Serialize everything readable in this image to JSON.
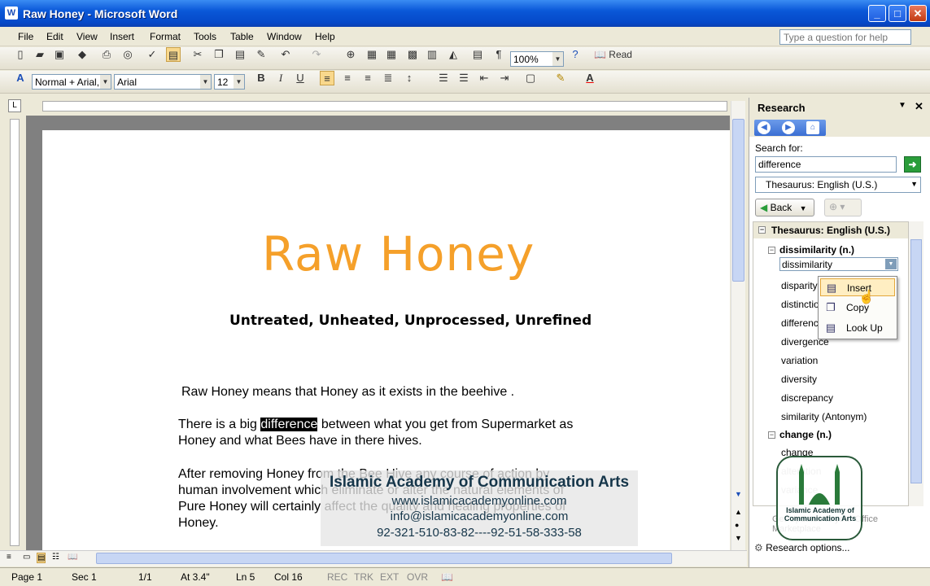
{
  "window": {
    "title": "Raw Honey - Microsoft Word",
    "app_icon": "W"
  },
  "menubar": {
    "items": [
      "File",
      "Edit",
      "View",
      "Insert",
      "Format",
      "Tools",
      "Table",
      "Window",
      "Help"
    ],
    "help_placeholder": "Type a question for help"
  },
  "toolbar1": {
    "zoom": "100%",
    "read_label": "Read"
  },
  "toolbar2": {
    "style": "Normal + Arial,",
    "font": "Arial",
    "size": "12"
  },
  "document": {
    "title": "Raw Honey",
    "subtitle": "Untreated, Unheated, Unprocessed, Unrefined",
    "para1": "Raw Honey means that Honey as it exists in the beehive .",
    "para2_before": "There is a big ",
    "para2_selected": "difference",
    "para2_after": " between what you get from Supermarket as",
    "para2_line2": "Honey and what Bees have in there hives.",
    "para3_line1": "After removing Honey from the Bee Hive any course of action by",
    "para3_line2": "human involvement which eliminate or alter the natural elements of",
    "para3_line3": "Pure Honey will certainly affect the quality and healing properties of",
    "para3_line4": "Honey."
  },
  "statusbar": {
    "page": "Page  1",
    "sec": "Sec  1",
    "pages": "1/1",
    "at": "At  3.4\"",
    "ln": "Ln  5",
    "col": "Col  16",
    "rec": "REC",
    "trk": "TRK",
    "ext": "EXT",
    "ovr": "OVR"
  },
  "research": {
    "title": "Research",
    "search_label": "Search for:",
    "search_value": "difference",
    "service": "Thesaurus: English (U.S.)",
    "back_label": "Back",
    "results_header": "Thesaurus: English (U.S.)",
    "sense1": "dissimilarity (n.)",
    "sense1_selected": "dissimilarity",
    "sense1_words": [
      "disparity",
      "distinction",
      "difference",
      "divergence",
      "variation",
      "diversity",
      "discrepancy",
      "similarity (Antonym)"
    ],
    "sense2": "change (n.)",
    "sense2_words": [
      "change",
      "alteration",
      "variance",
      "modification"
    ],
    "get_updates": "Get Updates to your Office Marketplace",
    "options": "Research options..."
  },
  "context_menu": {
    "items": [
      "Insert",
      "Copy",
      "Look Up"
    ]
  },
  "watermark": {
    "org": "Islamic Academy of Communication Arts",
    "url": "www.islamicacademyonline.com",
    "email": "info@islamicacademyonline.com",
    "phone": "92-321-510-83-82----92-51-58-333-58",
    "logo_text": "Islamic Academy of Communication Arts"
  },
  "colors": {
    "title_orange": "#f5a02a",
    "xp_blue": "#0a58d8"
  }
}
